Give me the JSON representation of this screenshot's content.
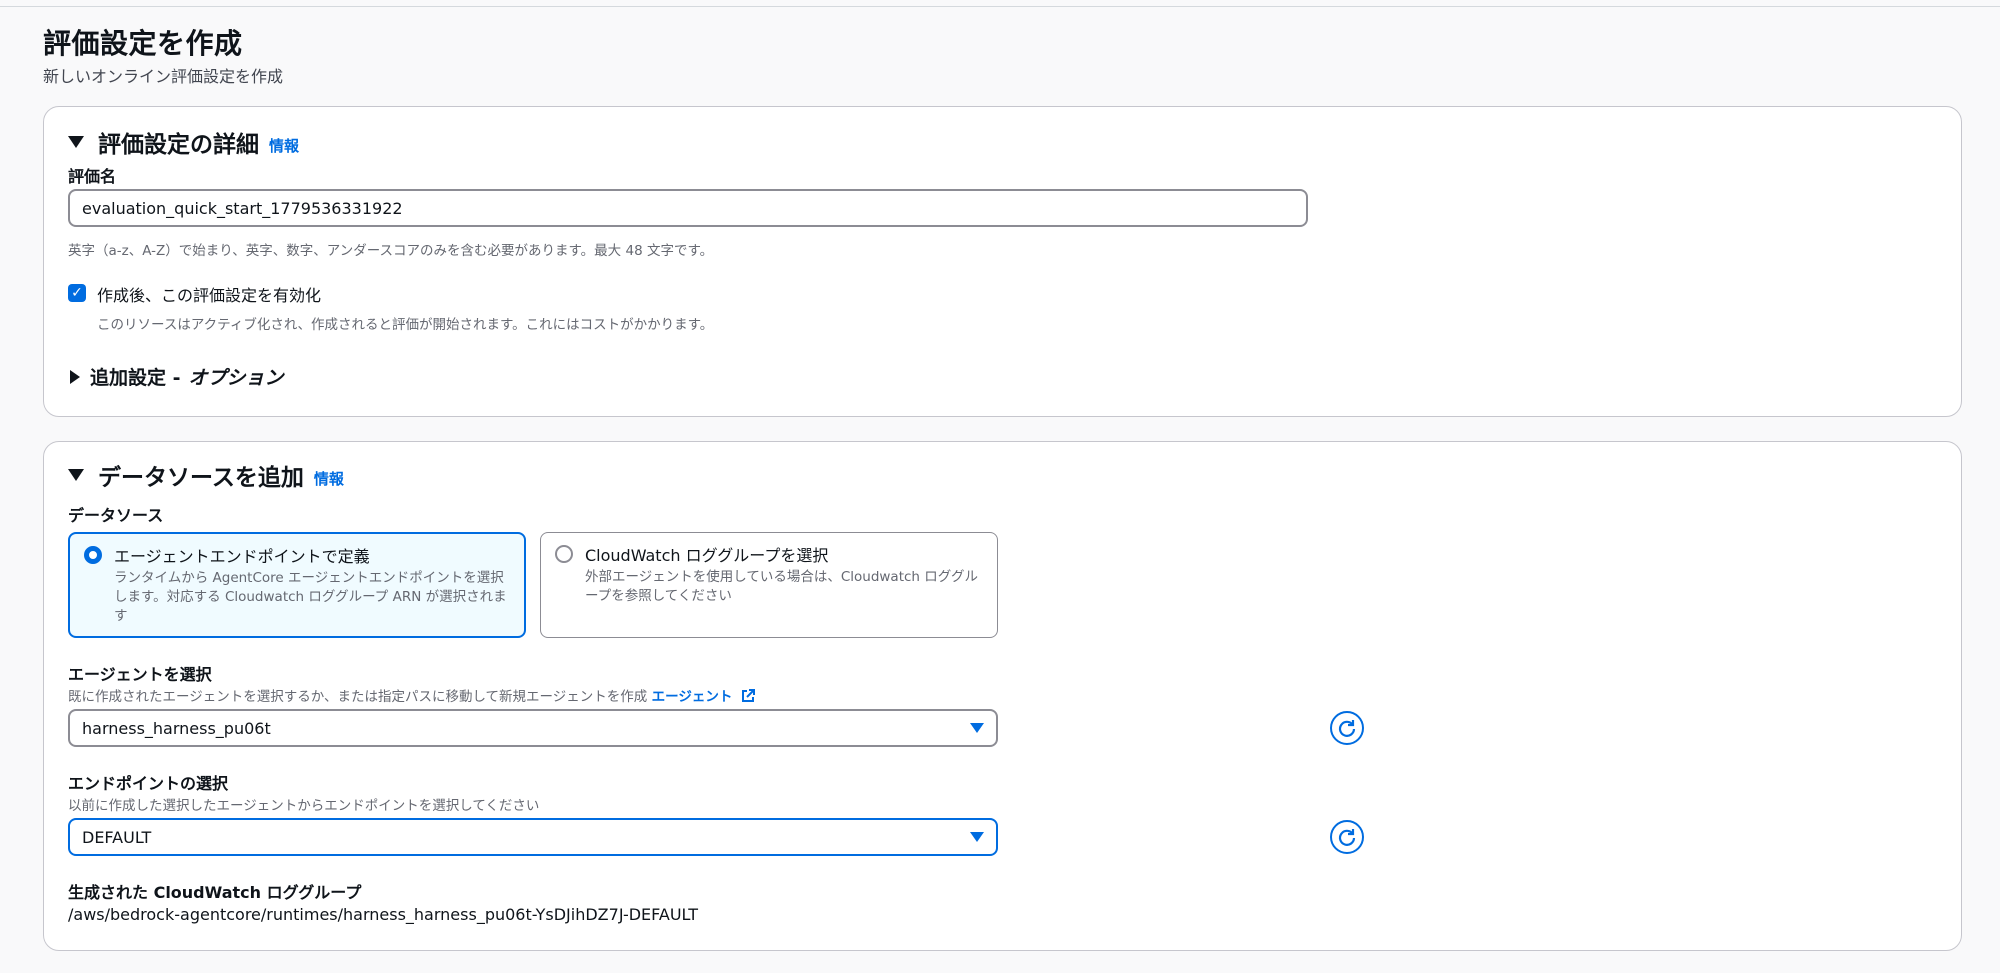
{
  "page": {
    "title": "評価設定を作成",
    "subtitle": "新しいオンライン評価設定を作成"
  },
  "details_section": {
    "title": "評価設定の詳細",
    "info": "情報",
    "name_label": "評価名",
    "name_value": "evaluation_quick_start_1779536331922",
    "name_hint": "英字（a-z、A-Z）で始まり、英字、数字、アンダースコアのみを含む必要があります。最大 48 文字です。",
    "enable_checkbox": {
      "label": "作成後、この評価設定を有効化",
      "description": "このリソースはアクティブ化され、作成されると評価が開始されます。これにはコストがかかります。",
      "checked": true
    },
    "additional_settings": {
      "label": "追加設定 -",
      "optional": "オプション"
    }
  },
  "datasource_section": {
    "title": "データソースを追加",
    "info": "情報",
    "datasource_label": "データソース",
    "options": [
      {
        "title": "エージェントエンドポイントで定義",
        "description": "ランタイムから AgentCore エージェントエンドポイントを選択します。対応する Cloudwatch ロググループ ARN が選択されます",
        "selected": true
      },
      {
        "title": "CloudWatch ロググループを選択",
        "description": "外部エージェントを使用している場合は、Cloudwatch ロググループを参照してください",
        "selected": false
      }
    ],
    "agent": {
      "label": "エージェントを選択",
      "hint": "既に作成されたエージェントを選択するか、または指定パスに移動して新規エージェントを作成",
      "hint_link": "エージェント",
      "value": "harness_harness_pu06t"
    },
    "endpoint": {
      "label": "エンドポイントの選択",
      "hint": "以前に作成した選択したエージェントからエンドポイントを選択してください",
      "value": "DEFAULT"
    },
    "log_group": {
      "label": "生成された CloudWatch ロググループ",
      "value": "/aws/bedrock-agentcore/runtimes/harness_harness_pu06t-YsDJihDZ7J-DEFAULT"
    }
  },
  "colors": {
    "accent": "#006ce0",
    "selected_tile_bg": "#f0fbff",
    "border": "#8c8c94",
    "text_secondary": "#656871"
  }
}
